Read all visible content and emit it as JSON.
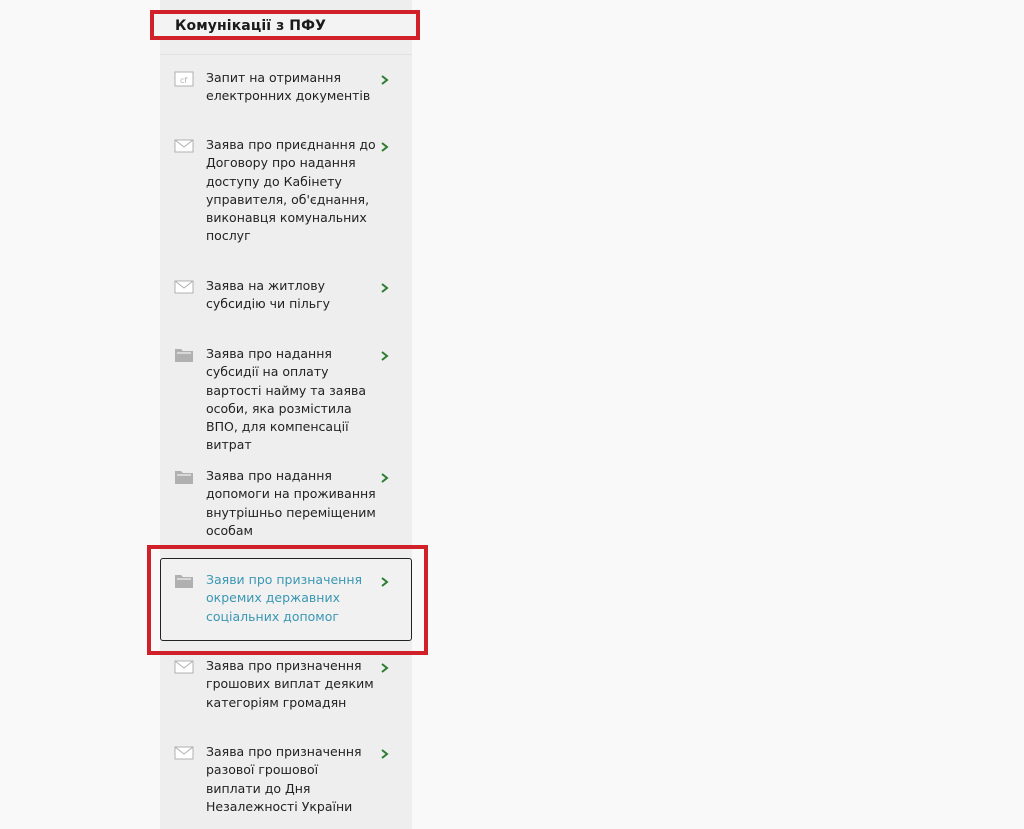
{
  "header": {
    "title": "Комунікації з ПФУ"
  },
  "colors": {
    "highlight": "#d0202a",
    "active_text": "#3a97b3",
    "chevron": "#2e7d32",
    "icon": "#b0b0b0"
  },
  "menu": [
    {
      "label": "Запит на отримання електронних документів",
      "icon": "document-icon",
      "active": false
    },
    {
      "label": "Заява про приєднання до Договору про надання доступу до Кабінету управителя, об'єднання, виконавця комунальних послуг",
      "icon": "envelope-icon",
      "active": false
    },
    {
      "label": "Заява на житлову субсидію чи пільгу",
      "icon": "envelope-icon",
      "active": false
    },
    {
      "label": "Заява про надання субсидії на оплату вартості найму та заява особи, яка розмістила ВПО, для компенсації витрат",
      "icon": "folder-icon",
      "active": false
    },
    {
      "label": "Заява про надання допомоги на проживання внутрішньо переміщеним особам",
      "icon": "folder-icon",
      "active": false
    },
    {
      "label": "Заяви про призначення окремих державних соціальних допомог",
      "icon": "folder-icon",
      "active": true
    },
    {
      "label": "Заява про призначення грошових виплат деяким категоріям громадян",
      "icon": "envelope-icon",
      "active": false
    },
    {
      "label": "Заява про призначення разової грошової виплати до Дня Незалежності України",
      "icon": "envelope-icon",
      "active": false
    }
  ]
}
